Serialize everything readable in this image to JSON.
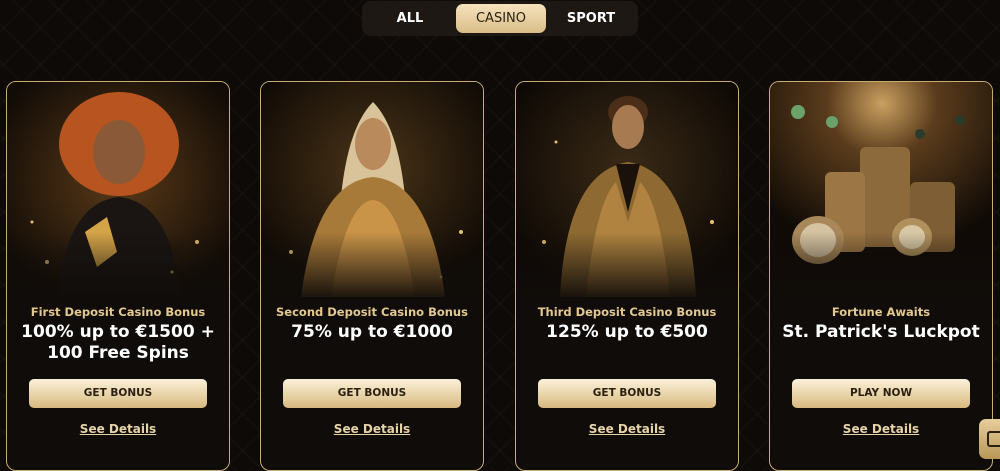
{
  "tabs": [
    {
      "label": "ALL"
    },
    {
      "label": "CASINO",
      "active": true
    },
    {
      "label": "SPORT"
    }
  ],
  "cards": [
    {
      "subtitle": "First Deposit Casino Bonus",
      "headline": "100% up to €1500 + 100 Free Spins",
      "button": "GET BONUS",
      "link": "See Details"
    },
    {
      "subtitle": "Second Deposit Casino Bonus",
      "headline": "75% up to €1000",
      "button": "GET BONUS",
      "link": "See Details"
    },
    {
      "subtitle": "Third Deposit Casino Bonus",
      "headline": "125% up to €500",
      "button": "GET BONUS",
      "link": "See Details"
    },
    {
      "subtitle": "Fortune Awaits",
      "headline": "St. Patrick's Luckpot",
      "button": "PLAY NOW",
      "link": "See Details"
    }
  ],
  "colors": {
    "background": "#0d0a08",
    "gold_accent": "#c9ac72",
    "subtitle_gold": "#e3c98f",
    "active_tab": "#e8d2a6",
    "button": "#f0dfb8"
  },
  "icons": {
    "chat_widget": "chat-icon"
  }
}
